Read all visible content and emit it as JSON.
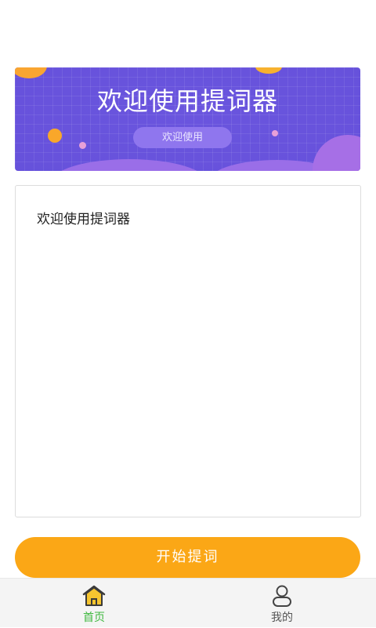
{
  "banner": {
    "title": "欢迎使用提词器",
    "button_label": "欢迎使用"
  },
  "editor": {
    "content": "欢迎使用提词器"
  },
  "start_button": {
    "label": "开始提词"
  },
  "tabbar": {
    "tabs": [
      {
        "label": "首页",
        "icon": "home-icon",
        "active": true
      },
      {
        "label": "我的",
        "icon": "user-icon",
        "active": false
      }
    ]
  },
  "colors": {
    "banner": "#6a55de",
    "accent": "#fba716",
    "active_tab": "#3fb83f"
  }
}
